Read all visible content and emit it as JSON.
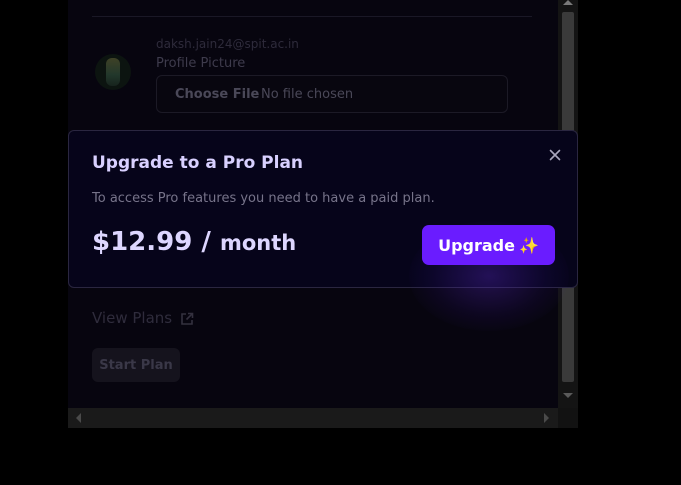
{
  "profile": {
    "email": "daksh.jain24@spit.ac.in",
    "picture_label": "Profile Picture",
    "choose_file_label": "Choose File",
    "file_status": "No file chosen"
  },
  "plans": {
    "view_plans_label": "View Plans",
    "start_plan_label": "Start Plan"
  },
  "modal": {
    "title": "Upgrade to a Pro Plan",
    "description": "To access Pro features you need to have a paid plan.",
    "price": "$12.99",
    "separator": "/",
    "period": "month",
    "upgrade_label": "Upgrade",
    "upgrade_icon": "✨",
    "close_icon": "close-icon"
  },
  "colors": {
    "accent": "#6a1cff",
    "modal_bg": "#06041a",
    "title_text": "#d8d0ff"
  }
}
